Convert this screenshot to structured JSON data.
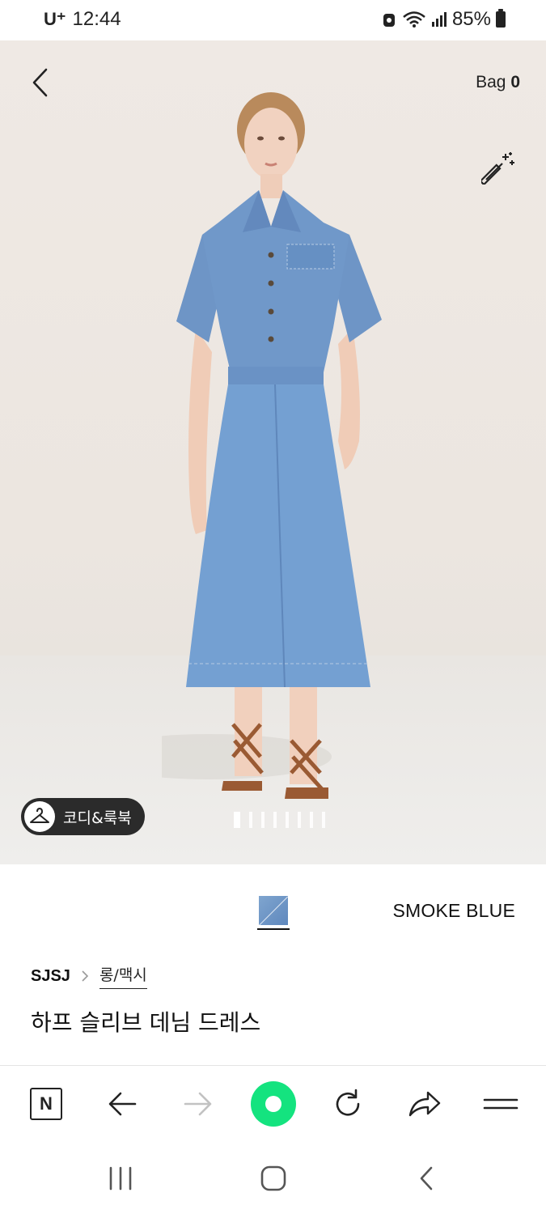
{
  "status_bar": {
    "carrier": "U⁺",
    "time": "12:44",
    "battery": "85%"
  },
  "header": {
    "bag_label": "Bag",
    "bag_count": "0"
  },
  "hero": {
    "lookbook_label": "코디&룩북",
    "slide_count": 8,
    "active_slide": 1
  },
  "product": {
    "color_name": "SMOKE BLUE",
    "brand": "SJSJ",
    "category": "롱/맥시",
    "title": "하프 슬리브 데님 드레스"
  },
  "browser_bar": {
    "items": [
      "naver-home-icon",
      "back-arrow-icon",
      "forward-arrow-icon",
      "green-dot-icon",
      "refresh-icon",
      "share-icon",
      "menu-icon"
    ]
  },
  "colors": {
    "accent_green": "#14e37f",
    "denim": "#6f96c8",
    "background_image": "#ece6e0"
  }
}
